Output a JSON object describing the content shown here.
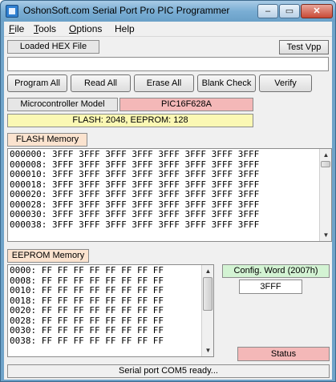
{
  "window": {
    "title": "OshonSoft.com Serial Port Pro PIC Programmer",
    "minimize_glyph": "–",
    "maximize_glyph": "▭",
    "close_glyph": "✕"
  },
  "menu": [
    {
      "label_first": "F",
      "label_rest": "ile"
    },
    {
      "label_first": "T",
      "label_rest": "ools"
    },
    {
      "label_first": "O",
      "label_rest": "ptions"
    },
    {
      "label_first": "",
      "label_rest": "Help"
    }
  ],
  "hex": {
    "loaded_label": "Loaded HEX File",
    "test_vpp_label": "Test Vpp",
    "file_path": ""
  },
  "actions": {
    "program_all": "Program All",
    "read_all": "Read All",
    "erase_all": "Erase All",
    "blank_check": "Blank Check",
    "verify": "Verify"
  },
  "device": {
    "model_label": "Microcontroller Model",
    "model_value": "PIC16F628A",
    "memory_info": "FLASH: 2048,  EEPROM: 128"
  },
  "flash": {
    "label": "FLASH Memory",
    "rows": [
      "000000: 3FFF 3FFF 3FFF 3FFF 3FFF 3FFF 3FFF 3FFF",
      "000008: 3FFF 3FFF 3FFF 3FFF 3FFF 3FFF 3FFF 3FFF",
      "000010: 3FFF 3FFF 3FFF 3FFF 3FFF 3FFF 3FFF 3FFF",
      "000018: 3FFF 3FFF 3FFF 3FFF 3FFF 3FFF 3FFF 3FFF",
      "000020: 3FFF 3FFF 3FFF 3FFF 3FFF 3FFF 3FFF 3FFF",
      "000028: 3FFF 3FFF 3FFF 3FFF 3FFF 3FFF 3FFF 3FFF",
      "000030: 3FFF 3FFF 3FFF 3FFF 3FFF 3FFF 3FFF 3FFF",
      "000038: 3FFF 3FFF 3FFF 3FFF 3FFF 3FFF 3FFF 3FFF"
    ],
    "scroll_position": 0.0
  },
  "eeprom": {
    "label": "EEPROM Memory",
    "rows": [
      "0000: FF FF FF FF FF FF FF FF",
      "0008: FF FF FF FF FF FF FF FF",
      "0010: FF FF FF FF FF FF FF FF",
      "0018: FF FF FF FF FF FF FF FF",
      "0020: FF FF FF FF FF FF FF FF",
      "0028: FF FF FF FF FF FF FF FF",
      "0030: FF FF FF FF FF FF FF FF",
      "0038: FF FF FF FF FF FF FF FF"
    ],
    "scroll_position": 0.0
  },
  "config": {
    "label": "Config. Word (2007h)",
    "value": "3FFF"
  },
  "status": {
    "label": "Status",
    "message": "Serial port COM5 ready..."
  },
  "colors": {
    "title_bar": "#7aaed4",
    "model_value_bg": "#f4b8b8",
    "memory_info_bg": "#fbf8b4",
    "section_label_bg": "#fbe3cf",
    "config_label_bg": "#d3f3d3",
    "status_bg": "#f4b8b8",
    "client_bg": "#f0f0f0"
  }
}
